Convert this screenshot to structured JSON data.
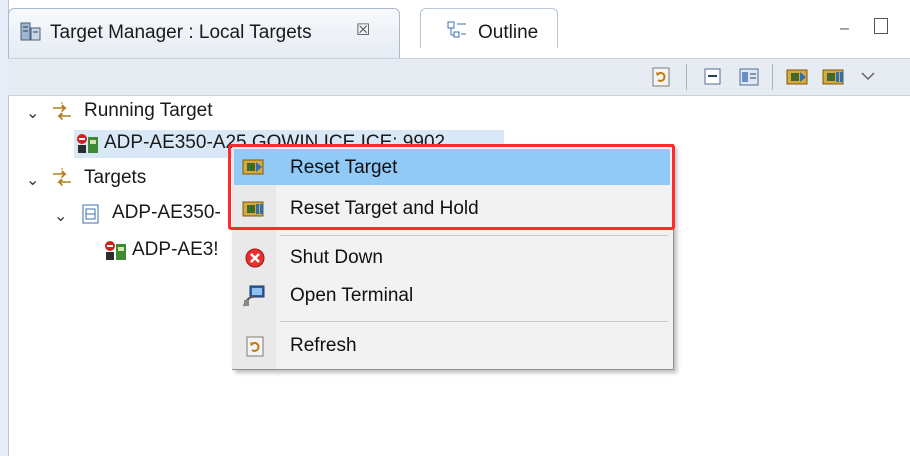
{
  "tabs": {
    "active_label": "Target Manager : Local Targets",
    "outline_label": "Outline",
    "close_glyph": "☒",
    "minimize_glyph": "–"
  },
  "toolbar": {
    "icons": [
      "refresh-icon",
      "collapse-all-icon",
      "view-menu-icon",
      "reset-target-icon",
      "reset-target-hold-icon",
      "dropdown-chevron-icon"
    ]
  },
  "tree": {
    "running_target_label": "Running Target",
    "running_child_label": "ADP-AE350-A25 GOWIN ICE ICE: 9902",
    "targets_label": "Targets",
    "targets_child_label": "ADP-AE350-",
    "targets_grandchild_label": "ADP-AE3!"
  },
  "menu": {
    "items": [
      {
        "label": "Reset Target",
        "icon": "reset-target-icon"
      },
      {
        "label": "Reset Target and Hold",
        "icon": "reset-target-hold-icon"
      },
      {
        "label": "Shut Down",
        "icon": "shutdown-icon"
      },
      {
        "label": "Open Terminal",
        "icon": "terminal-icon"
      },
      {
        "label": "Refresh",
        "icon": "refresh-icon"
      }
    ],
    "highlight_color": "#ff2b2b",
    "hover_color": "#91c9f7"
  }
}
